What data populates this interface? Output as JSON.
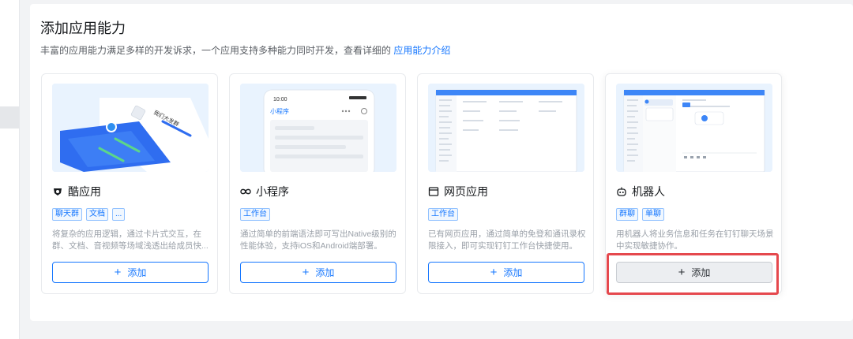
{
  "page": {
    "title": "添加应用能力",
    "subtitle_text": "丰富的应用能力满足多样的开发诉求，一个应用支持多种能力同时开发，查看详细的",
    "subtitle_link": "应用能力介绍"
  },
  "cards": [
    {
      "title": "酷应用",
      "icon": "cool-app-icon",
      "tags": [
        "聊天群",
        "文档",
        "..."
      ],
      "description": "将复杂的应用逻辑，通过卡片式交互，在群、文档、音视频等场域浅透出给成员快...",
      "button": "添加",
      "thumb_text": [
        "我们大发群"
      ]
    },
    {
      "title": "小程序",
      "icon": "mini-program-icon",
      "tags": [
        "工作台"
      ],
      "description": "通过简单的前端语法即可写出Native级别的性能体验，支持iOS和Android端部署。",
      "button": "添加",
      "thumb_text": [
        "10:00",
        "小程序"
      ]
    },
    {
      "title": "网页应用",
      "icon": "web-app-icon",
      "tags": [
        "工作台"
      ],
      "description": "已有网页应用，通过简单的免登和通讯录权限接入，即可实现钉钉工作台快捷使用。",
      "button": "添加",
      "thumb_text": []
    },
    {
      "title": "机器人",
      "icon": "robot-icon",
      "tags": [
        "群聊",
        "单聊"
      ],
      "description": "用机器人将业务信息和任务在钉钉聊天场景中实现敏捷协作。",
      "button": "添加",
      "thumb_text": []
    }
  ],
  "colors": {
    "accent": "#1677ff",
    "highlight": "#e5484d",
    "background": "#f2f3f5"
  }
}
